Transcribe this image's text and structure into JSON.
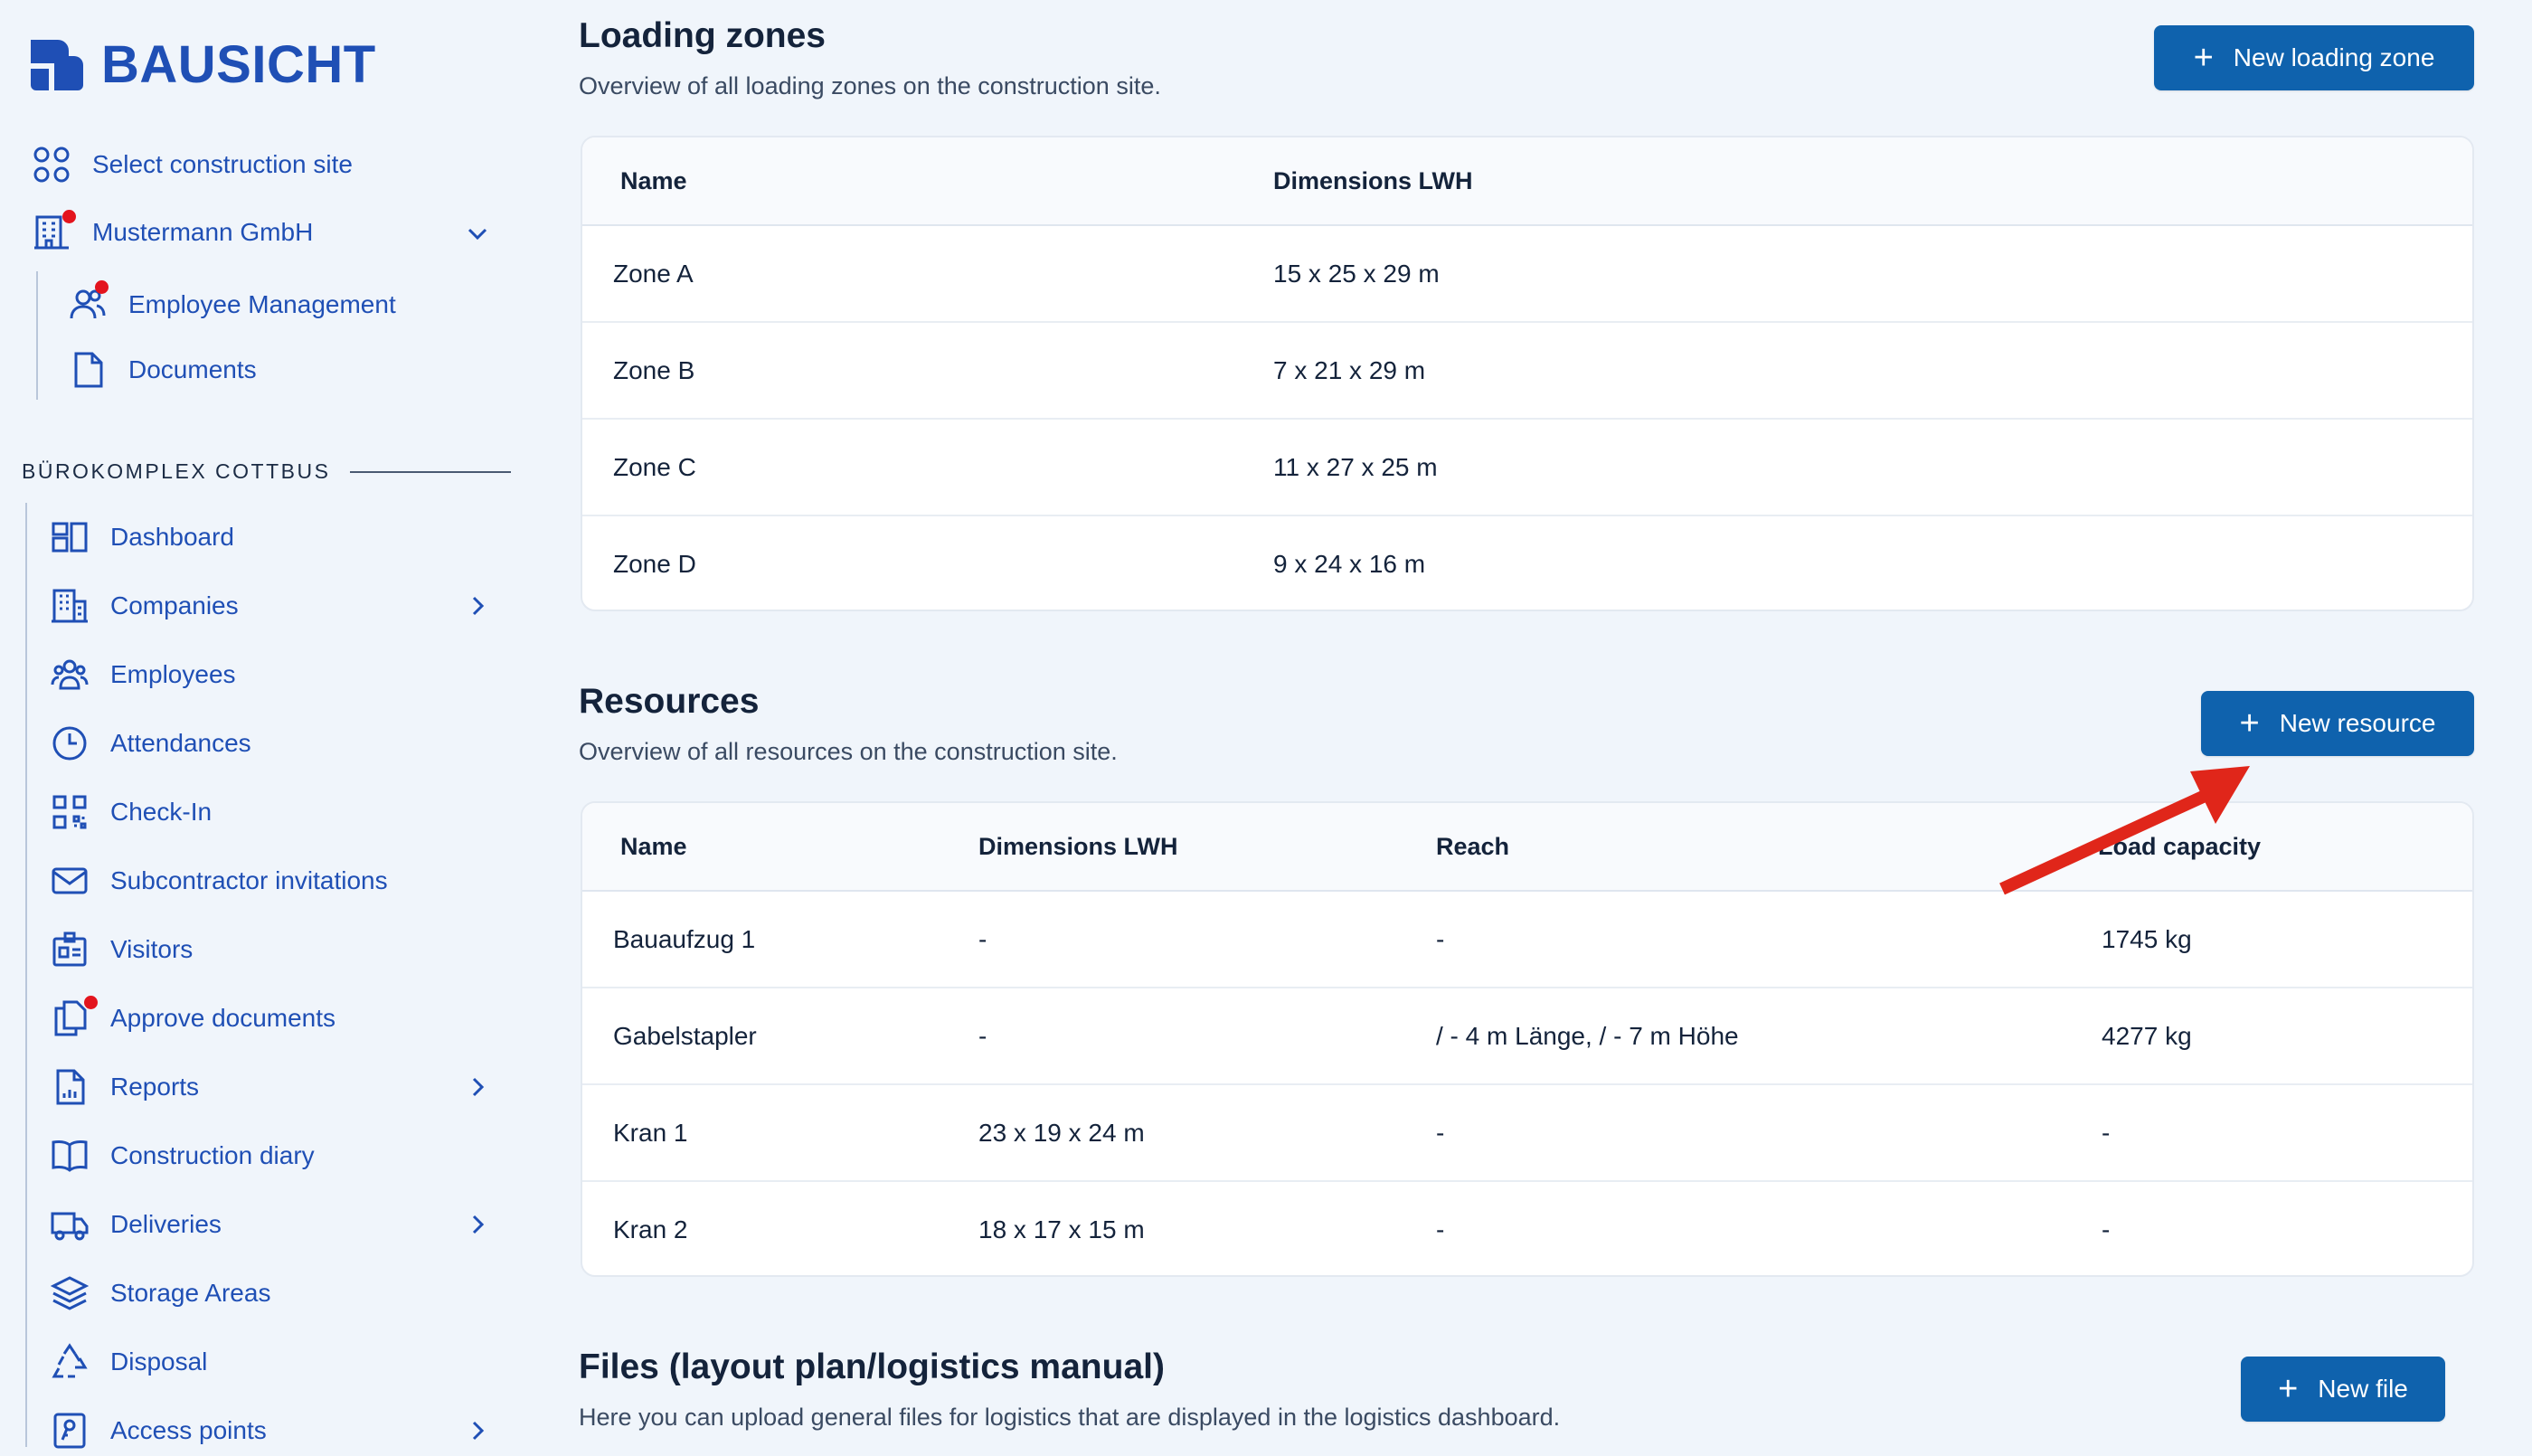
{
  "brand": {
    "name": "BAUSICHT"
  },
  "sidebar": {
    "top_items": [
      {
        "label": "Select construction site",
        "icon": "grid-icon"
      },
      {
        "label": "Mustermann GmbH",
        "icon": "building-icon",
        "badge": true,
        "expanded": true
      },
      {
        "label": "Employee Management",
        "icon": "users-icon",
        "badge": true
      },
      {
        "label": "Documents",
        "icon": "document-icon"
      }
    ],
    "section_title": "BÜROKOMPLEX COTTBUS",
    "items": [
      {
        "label": "Dashboard",
        "icon": "dashboard-icon"
      },
      {
        "label": "Companies",
        "icon": "office-icon",
        "has_children": true
      },
      {
        "label": "Employees",
        "icon": "team-icon"
      },
      {
        "label": "Attendances",
        "icon": "clock-icon"
      },
      {
        "label": "Check-In",
        "icon": "qr-code-icon"
      },
      {
        "label": "Subcontractor invitations",
        "icon": "envelope-icon"
      },
      {
        "label": "Visitors",
        "icon": "id-card-icon"
      },
      {
        "label": "Approve documents",
        "icon": "documents-icon",
        "badge": true
      },
      {
        "label": "Reports",
        "icon": "report-icon",
        "has_children": true
      },
      {
        "label": "Construction diary",
        "icon": "book-icon"
      },
      {
        "label": "Deliveries",
        "icon": "truck-icon",
        "has_children": true
      },
      {
        "label": "Storage Areas",
        "icon": "layers-icon"
      },
      {
        "label": "Disposal",
        "icon": "recycle-icon"
      },
      {
        "label": "Access points",
        "icon": "access-key-icon",
        "has_children": true
      }
    ]
  },
  "loading_zones": {
    "title": "Loading zones",
    "subtitle": "Overview of all loading zones on the construction site.",
    "button_label": "New loading zone",
    "columns": [
      "Name",
      "Dimensions LWH"
    ],
    "rows": [
      [
        "Zone A",
        "15 x 25 x 29 m"
      ],
      [
        "Zone B",
        "7 x 21 x 29 m"
      ],
      [
        "Zone C",
        "11 x 27 x 25 m"
      ],
      [
        "Zone D",
        "9 x 24 x 16 m"
      ]
    ]
  },
  "resources": {
    "title": "Resources",
    "subtitle": "Overview of all resources on the construction site.",
    "button_label": "New resource",
    "columns": [
      "Name",
      "Dimensions LWH",
      "Reach",
      "Load capacity"
    ],
    "rows": [
      [
        "Bauaufzug 1",
        "-",
        "-",
        "1745 kg"
      ],
      [
        "Gabelstapler",
        "-",
        "/ - 4 m Länge, / - 7 m Höhe",
        "4277 kg"
      ],
      [
        "Kran 1",
        "23 x 19 x 24 m",
        "-",
        "-"
      ],
      [
        "Kran 2",
        "18 x 17 x 15 m",
        "-",
        "-"
      ]
    ]
  },
  "files": {
    "title": "Files (layout plan/logistics manual)",
    "subtitle": "Here you can upload general files for logistics that are displayed in the logistics dashboard.",
    "button_label": "New file"
  },
  "colors": {
    "primary": "#0f62ad",
    "nav": "#1f4fb5",
    "badge": "#e3141d",
    "annotation_arrow": "#e0261a"
  }
}
